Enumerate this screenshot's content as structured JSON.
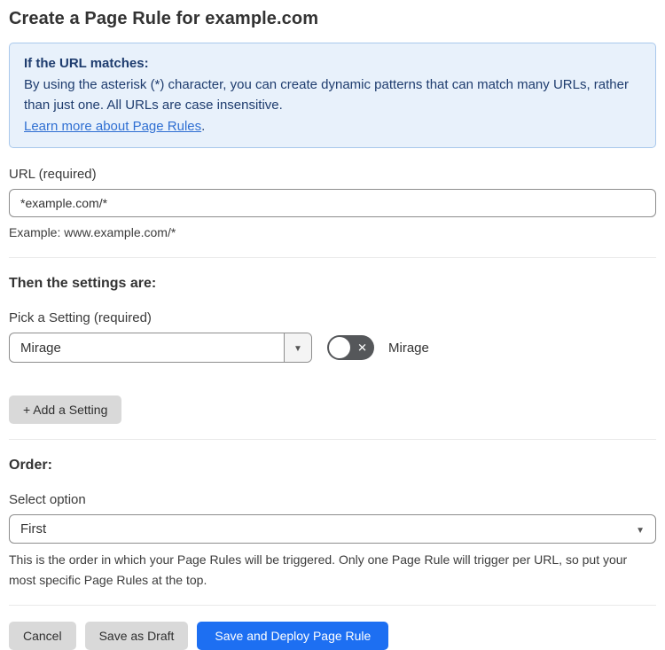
{
  "page": {
    "title": "Create a Page Rule for example.com"
  },
  "info_box": {
    "heading": "If the URL matches:",
    "body": "By using the asterisk (*) character, you can create dynamic patterns that can match many URLs, rather than just one. All URLs are case insensitive.",
    "link_label": "Learn more about Page Rules",
    "link_suffix": "."
  },
  "url_field": {
    "label": "URL (required)",
    "value": "*example.com/*",
    "helper": "Example: www.example.com/*"
  },
  "settings_section": {
    "heading": "Then the settings are:",
    "picker_label": "Pick a Setting (required)",
    "picker_value": "Mirage",
    "toggle_label": "Mirage",
    "toggle_state": "off",
    "add_setting_label": "+ Add a Setting"
  },
  "order_section": {
    "heading": "Order:",
    "select_label": "Select option",
    "select_value": "First",
    "helper": "This is the order in which your Page Rules will be triggered. Only one Page Rule will trigger per URL, so put your most specific Page Rules at the top."
  },
  "footer": {
    "cancel_label": "Cancel",
    "save_draft_label": "Save as Draft",
    "save_deploy_label": "Save and Deploy Page Rule"
  },
  "icons": {
    "dropdown_arrow": "▼",
    "toggle_off_x": "✕"
  },
  "colors": {
    "accent_blue": "#1d6ff2",
    "info_bg": "#e8f1fb",
    "info_border": "#a9c8ec",
    "info_text": "#1e3c6e",
    "link_blue": "#2f6fd2",
    "toggle_off_bg": "#55575a",
    "button_gray": "#d9d9d9"
  }
}
